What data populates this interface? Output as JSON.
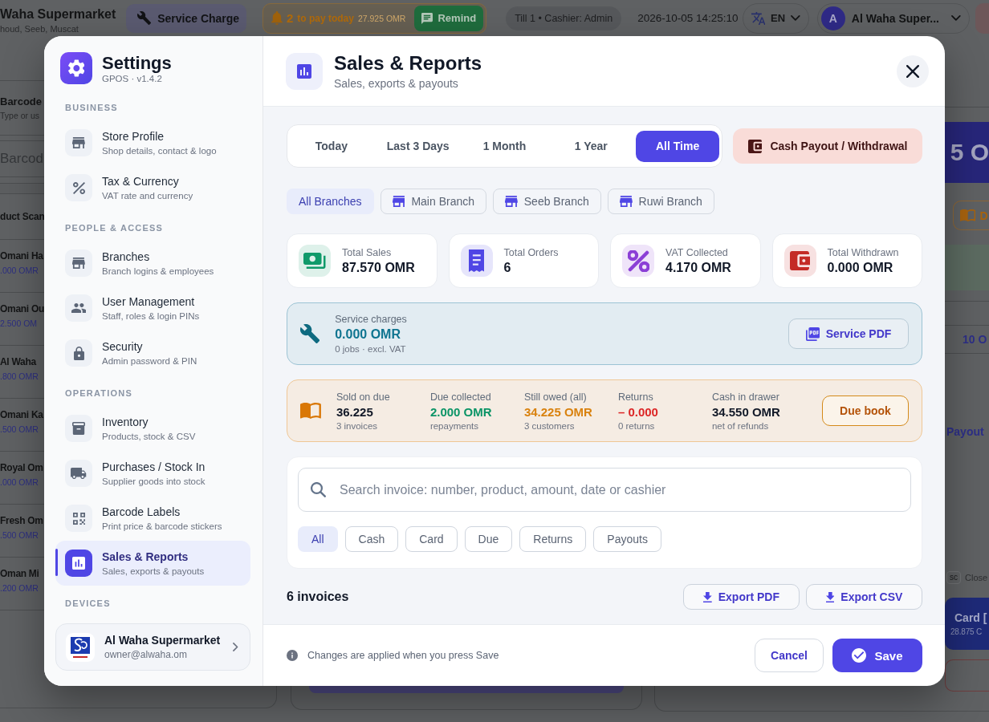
{
  "app": {
    "top_bar": {
      "store_name": "Waha Supermarket",
      "store_address": "houd, Seeb, Muscat",
      "service_button": "Service Charge",
      "due_alert": {
        "count": "2",
        "label": "to pay today",
        "amount": "27.925 OMR",
        "button": "Remind"
      },
      "till": "Till 1 • Cashier: Admin",
      "datetime": "2026-10-05 14:25:10",
      "language": "EN",
      "user": {
        "initial": "A",
        "name": "Al Waha Super..."
      }
    },
    "left_panel": {
      "title": "Barcode",
      "hint": "Type or us",
      "barcode_field": {
        "placeholder": "Barcod"
      },
      "heading": "duct Scan",
      "products": [
        {
          "name": "Omani Ha",
          "price": ".000 OMR"
        },
        {
          "name": "Omani Ou",
          "price": "2.500 OM"
        },
        {
          "name": "Al Waha",
          "price": ".800 OMR"
        },
        {
          "name": "Omani Ka",
          "price": ".500 OMR"
        },
        {
          "name": "Royal Om",
          "price": ".000 OMR"
        },
        {
          "name": "Fresh Om",
          "price": ".500 OMR"
        },
        {
          "name": "Oman Mi",
          "price": ".200 OMR"
        }
      ]
    },
    "right_panel": {
      "total": "5 O",
      "due_button": "D",
      "row_amount": "10 O",
      "payout": "Payout",
      "shortcut_key": "sc",
      "shortcut_label": "Close",
      "card_button": {
        "label": "Card [",
        "amount": "28.875 C"
      }
    }
  },
  "settings": {
    "sidebar": {
      "title": "Settings",
      "version": "GPOS · v1.4.2",
      "sections": [
        {
          "heading": "BUSINESS",
          "items": [
            {
              "title": "Store Profile",
              "subtitle": "Shop details, contact & logo",
              "selected": false
            },
            {
              "title": "Tax & Currency",
              "subtitle": "VAT rate and currency",
              "selected": false
            }
          ]
        },
        {
          "heading": "PEOPLE & ACCESS",
          "items": [
            {
              "title": "Branches",
              "subtitle": "Branch logins & employees",
              "selected": false
            },
            {
              "title": "User Management",
              "subtitle": "Staff, roles & login PINs",
              "selected": false
            },
            {
              "title": "Security",
              "subtitle": "Admin password & PIN",
              "selected": false
            }
          ]
        },
        {
          "heading": "OPERATIONS",
          "items": [
            {
              "title": "Inventory",
              "subtitle": "Products, stock & CSV",
              "selected": false
            },
            {
              "title": "Purchases / Stock In",
              "subtitle": "Supplier goods into stock",
              "selected": false
            },
            {
              "title": "Barcode Labels",
              "subtitle": "Print price & barcode stickers",
              "selected": false
            },
            {
              "title": "Sales & Reports",
              "subtitle": "Sales, exports & payouts",
              "selected": true
            }
          ]
        }
      ],
      "devices": {
        "heading": "DEVICES",
        "name": "Al Waha Supermarket",
        "email": "owner@alwaha.om"
      }
    },
    "header": {
      "title": "Sales & Reports",
      "subtitle": "Sales, exports & payouts"
    },
    "periods": [
      {
        "label": "Today",
        "selected": false
      },
      {
        "label": "Last 3 Days",
        "selected": false
      },
      {
        "label": "1 Month",
        "selected": false
      },
      {
        "label": "1 Year",
        "selected": false
      },
      {
        "label": "All Time",
        "selected": true
      }
    ],
    "payout_button": "Cash Payout / Withdrawal",
    "branches": [
      {
        "label": "All Branches",
        "kind": "all",
        "selected": true
      },
      {
        "label": "Main Branch",
        "kind": "branch",
        "selected": false
      },
      {
        "label": "Seeb Branch",
        "kind": "branch",
        "selected": false
      },
      {
        "label": "Ruwi Branch",
        "kind": "branch",
        "selected": false
      }
    ],
    "stats": [
      {
        "label": "Total Sales",
        "value": "87.570 OMR",
        "color": "#109a6a"
      },
      {
        "label": "Total Orders",
        "value": "6",
        "color": "#4f46e5"
      },
      {
        "label": "VAT Collected",
        "value": "4.170 OMR",
        "color": "#8b3fd6"
      },
      {
        "label": "Total Withdrawn",
        "value": "0.000 OMR",
        "color": "#c42b26"
      }
    ],
    "service": {
      "label": "Service charges",
      "value": "0.000 OMR",
      "note": "0 jobs · excl. VAT",
      "button": "Service PDF"
    },
    "due": {
      "columns": [
        {
          "label": "Sold on due",
          "value": "36.225",
          "note": "3 invoices",
          "color": "#111827"
        },
        {
          "label": "Due collected",
          "value": "2.000 OMR",
          "note": "repayments",
          "color": "#0b9466"
        },
        {
          "label": "Still owed (all)",
          "value": "34.225 OMR",
          "note": "3 customers",
          "color": "#d9820f"
        },
        {
          "label": "Returns",
          "value": "– 0.000",
          "note": "0 returns",
          "color": "#dc2626"
        },
        {
          "label": "Cash in drawer",
          "value": "34.550 OMR",
          "note": "net of refunds",
          "color": "#111827"
        }
      ],
      "button": "Due book"
    },
    "search": {
      "placeholder": "Search invoice: number, product, amount, date or cashier"
    },
    "filters": [
      {
        "label": "All",
        "selected": true
      },
      {
        "label": "Cash",
        "selected": false
      },
      {
        "label": "Card",
        "selected": false
      },
      {
        "label": "Due",
        "selected": false
      },
      {
        "label": "Returns",
        "selected": false
      },
      {
        "label": "Payouts",
        "selected": false
      }
    ],
    "invoice_count": "6 invoices",
    "exports": [
      "Export PDF",
      "Export CSV"
    ],
    "footer": {
      "note": "Changes are applied when you press Save",
      "cancel": "Cancel",
      "save": "Save"
    }
  }
}
